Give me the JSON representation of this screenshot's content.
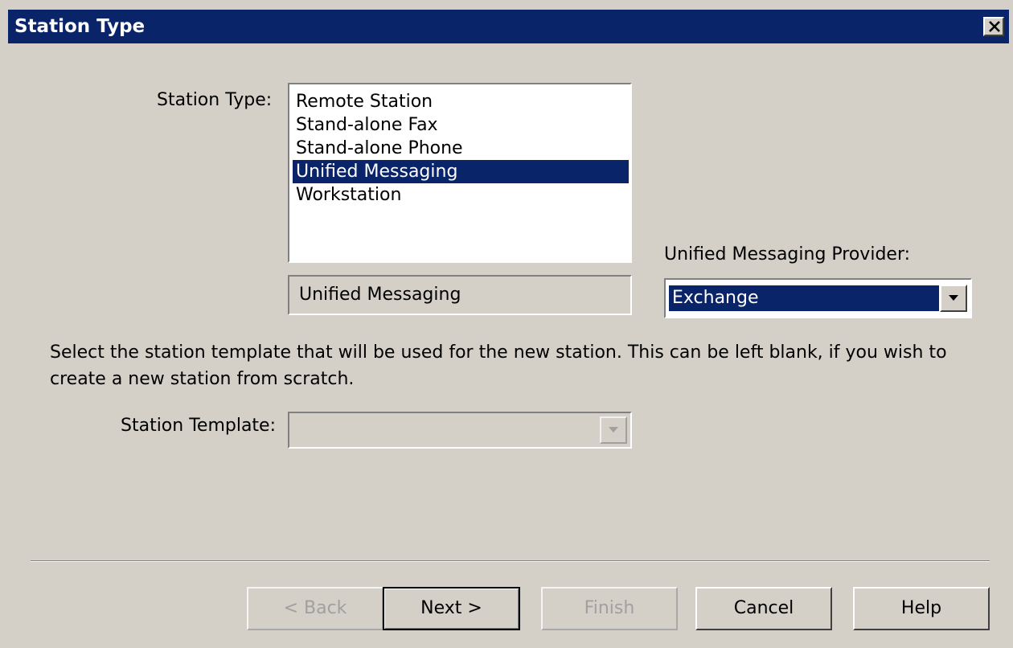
{
  "window": {
    "title": "Station Type"
  },
  "station_type": {
    "label": "Station Type:",
    "items": [
      "Remote Station",
      "Stand-alone Fax",
      "Stand-alone Phone",
      "Unified Messaging",
      "Workstation"
    ],
    "selected_index": 3,
    "selected_value": "Unified Messaging"
  },
  "provider": {
    "label": "Unified Messaging Provider:",
    "value": "Exchange"
  },
  "instructions": {
    "line1": "Select the station template that will be used for the new station. This can be left blank, if you wish to",
    "line2": "create a new station from scratch."
  },
  "template": {
    "label": "Station Template:",
    "value": ""
  },
  "buttons": {
    "back": "< Back",
    "next": "Next >",
    "finish": "Finish",
    "cancel": "Cancel",
    "help": "Help"
  },
  "colors": {
    "face": "#d4d0c8",
    "title_bar": "#0a246a",
    "selection": "#0a246a"
  }
}
